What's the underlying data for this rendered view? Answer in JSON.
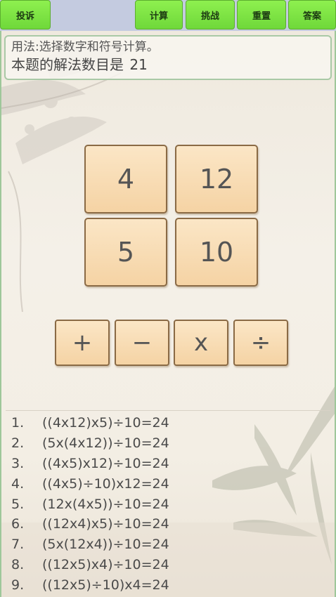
{
  "toolbar": {
    "complain": "投诉",
    "calculate": "计算",
    "challenge": "挑战",
    "reset": "重置",
    "answer": "答案"
  },
  "info": {
    "usage": "用法:选择数字和符号计算。",
    "solutions_label": "本题的解法数目是",
    "solutions_count": "21"
  },
  "numbers": [
    "4",
    "12",
    "5",
    "10"
  ],
  "operators": [
    "+",
    "−",
    "x",
    "÷"
  ],
  "solutions": [
    {
      "index": "1.",
      "expr": "((4x12)x5)÷10=24"
    },
    {
      "index": "2.",
      "expr": "(5x(4x12))÷10=24"
    },
    {
      "index": "3.",
      "expr": "((4x5)x12)÷10=24"
    },
    {
      "index": "4.",
      "expr": "((4x5)÷10)x12=24"
    },
    {
      "index": "5.",
      "expr": "(12x(4x5))÷10=24"
    },
    {
      "index": "6.",
      "expr": "((12x4)x5)÷10=24"
    },
    {
      "index": "7.",
      "expr": "(5x(12x4))÷10=24"
    },
    {
      "index": "8.",
      "expr": "((12x5)x4)÷10=24"
    },
    {
      "index": "9.",
      "expr": "((12x5)÷10)x4=24"
    }
  ],
  "colors": {
    "toolbar_button": "#7ae043",
    "tile_fill": "#f7d9ae",
    "tile_border": "#8a6a45",
    "panel_border": "#9ec79a"
  }
}
